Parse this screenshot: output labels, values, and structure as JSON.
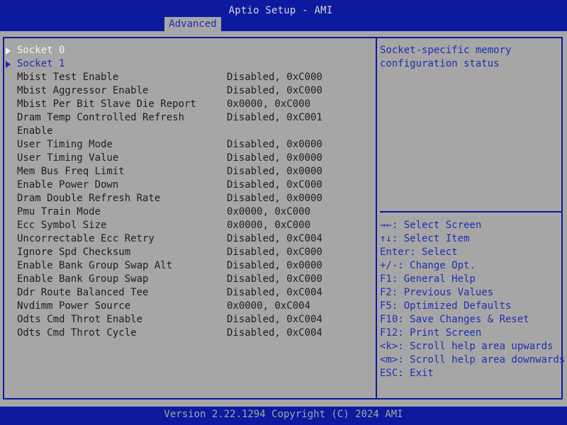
{
  "header": {
    "title": "Aptio Setup - AMI",
    "tab": "Advanced"
  },
  "menu": {
    "submenus": [
      {
        "label": "Socket 0",
        "highlighted": true
      },
      {
        "label": "Socket 1",
        "highlighted": false
      }
    ],
    "settings": [
      {
        "label": "Mbist Test Enable",
        "value": "Disabled, 0xC000"
      },
      {
        "label": "Mbist Aggressor Enable",
        "value": "Disabled, 0xC000"
      },
      {
        "label": "Mbist Per Bit Slave Die Report",
        "value": "0x0000, 0xC000"
      },
      {
        "label": "Dram Temp Controlled Refresh",
        "label_line2": "Enable",
        "value": "Disabled, 0xC001"
      },
      {
        "label": "User Timing Mode",
        "value": "Disabled, 0x0000"
      },
      {
        "label": "User Timing Value",
        "value": "Disabled, 0x0000"
      },
      {
        "label": "Mem Bus Freq Limit",
        "value": "Disabled, 0x0000"
      },
      {
        "label": "Enable Power Down",
        "value": "Disabled, 0xC000"
      },
      {
        "label": "Dram Double Refresh Rate",
        "value": "Disabled, 0x0000"
      },
      {
        "label": "Pmu Train Mode",
        "value": "0x0000, 0xC000"
      },
      {
        "label": "Ecc Symbol Size",
        "value": "0x0000, 0xC000"
      },
      {
        "label": "Uncorrectable Ecc Retry",
        "value": "Disabled, 0xC004"
      },
      {
        "label": "Ignore Spd Checksum",
        "value": "Disabled, 0xC000"
      },
      {
        "label": "Enable Bank Group Swap Alt",
        "value": "Disabled, 0x0000"
      },
      {
        "label": "Enable Bank Group Swap",
        "value": "Disabled, 0xC000"
      },
      {
        "label": "Ddr Route Balanced Tee",
        "value": "Disabled, 0xC004"
      },
      {
        "label": "Nvdimm Power Source",
        "value": "0x0000, 0xC004"
      },
      {
        "label": "Odts Cmd Throt Enable",
        "value": "Disabled, 0xC004"
      },
      {
        "label": "Odts Cmd Throt Cycle",
        "value": "Disabled, 0xC004"
      }
    ]
  },
  "help": {
    "lines": [
      "Socket-specific memory",
      "configuration status"
    ]
  },
  "keys": [
    "→←: Select Screen",
    "↑↓: Select Item",
    "Enter: Select",
    "+/-: Change Opt.",
    "F1: General Help",
    "F2: Previous Values",
    "F5: Optimized Defaults",
    "F10: Save Changes & Reset",
    "F12: Print Screen",
    "<k>: Scroll help area upwards",
    "<m>: Scroll help area downwards",
    "ESC: Exit"
  ],
  "footer": {
    "version": "Version 2.22.1294 Copyright (C) 2024 AMI"
  },
  "colors": {
    "bar_blue": "#0b1a9e",
    "panel_gray": "#a6a6a6",
    "highlight_white": "#f2f2f2",
    "text_blue": "#1f2fb0"
  }
}
